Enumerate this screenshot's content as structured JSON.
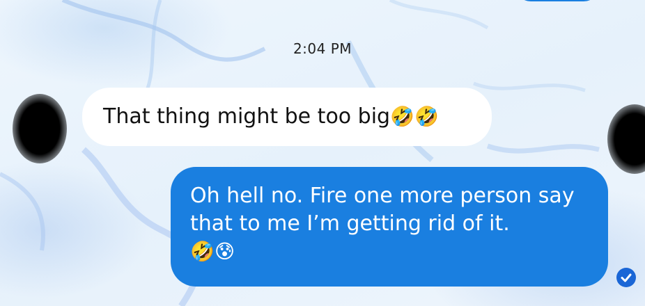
{
  "conversation": {
    "timestamp": "2:04 PM",
    "messages": [
      {
        "direction": "incoming",
        "text": "That thing might be too big",
        "emojis": "🤣🤣"
      },
      {
        "direction": "outgoing",
        "text": "Oh hell no. Fire one more person say that to me I’m getting rid of it.",
        "emojis": "🤣😰"
      }
    ],
    "read_receipt_icon": "checkmark-circle-icon"
  },
  "colors": {
    "outgoing_bubble": "#1a7fe0",
    "incoming_bubble": "#ffffff",
    "read_receipt": "#1a66d6"
  }
}
